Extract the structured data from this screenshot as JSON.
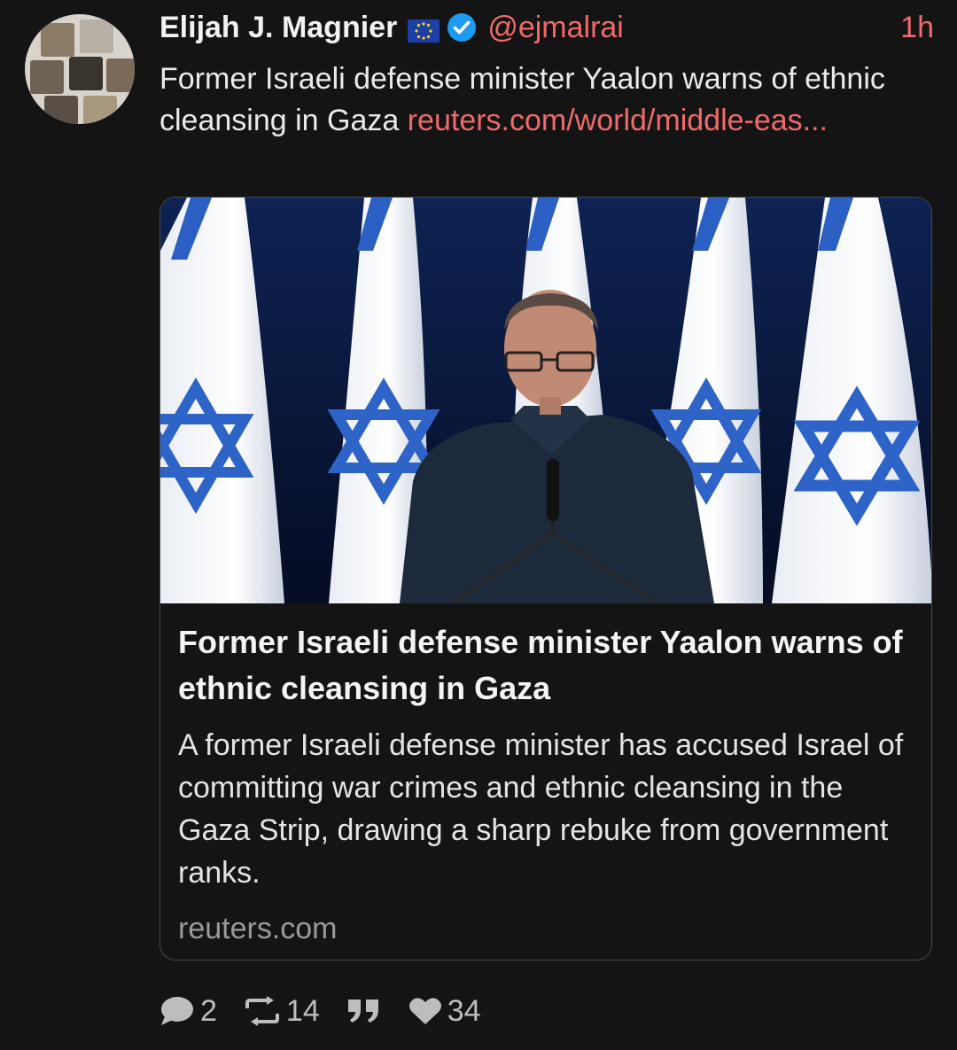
{
  "post": {
    "author": {
      "display_name": "Elijah J. Magnier",
      "handle": "@ejmalrai",
      "flag_icon": "eu-flag-icon",
      "verified_icon": "verified-badge-icon"
    },
    "time": "1h",
    "text": "Former Israeli defense minister Yaalon warns of ethnic cleansing in Gaza ",
    "link_text": "reuters.com/world/middle-eas..."
  },
  "card": {
    "image_alt": "Man in dark shirt speaking at microphone in front of Israeli flags",
    "title": "Former Israeli defense minister Yaalon warns of ethnic cleansing in Gaza",
    "description": "A former Israeli defense minister has accused Israel of committing war crimes and ethnic cleansing in the Gaza Strip, drawing a sharp rebuke from government ranks.",
    "domain": "reuters.com"
  },
  "actions": {
    "replies": {
      "icon": "comment-icon",
      "count": "2"
    },
    "boosts": {
      "icon": "repost-icon",
      "count": "14"
    },
    "quote": {
      "icon": "quote-icon"
    },
    "likes": {
      "icon": "heart-icon",
      "count": "34"
    }
  },
  "colors": {
    "background": "#141414",
    "accent": "#f06a6a",
    "text": "#eaeaea",
    "muted": "#9a9a9a",
    "verified": "#1d9bf0"
  }
}
